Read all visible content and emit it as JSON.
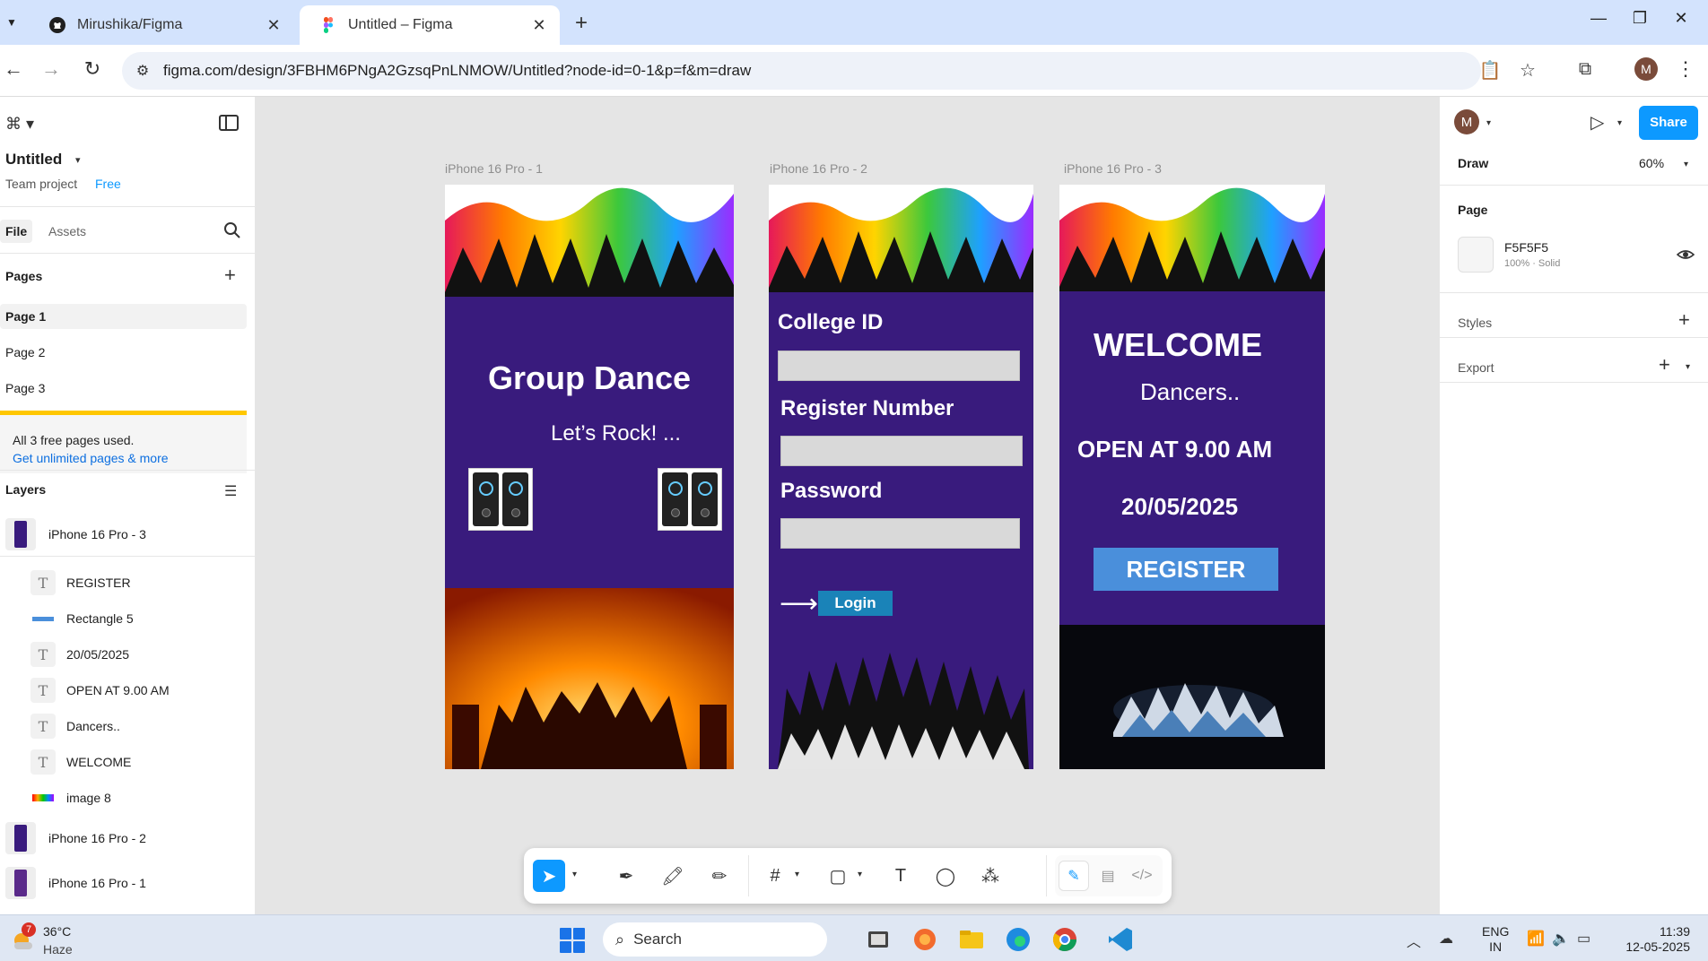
{
  "browser": {
    "tabs": [
      {
        "label": "Mirushika/Figma",
        "icon": "github-icon"
      },
      {
        "label": "Untitled – Figma",
        "icon": "figma-icon"
      }
    ],
    "url": "figma.com/design/3FBHM6PNgA2GzsqPnLNMOW/Untitled?node-id=0-1&p=f&m=draw",
    "profile_initial": "M"
  },
  "left_panel": {
    "file_title": "Untitled",
    "team": "Team project",
    "plan": "Free",
    "tabs": {
      "file": "File",
      "assets": "Assets"
    },
    "pages_heading": "Pages",
    "pages": [
      "Page 1",
      "Page 2",
      "Page 3"
    ],
    "banner": {
      "text": "All 3 free pages used.",
      "link": "Get unlimited pages & more"
    },
    "layers_heading": "Layers",
    "layers": {
      "frame3": "iPhone 16 Pro - 3",
      "children": [
        "REGISTER",
        "Rectangle 5",
        "20/05/2025",
        "OPEN AT 9.00 AM",
        "Dancers..",
        "WELCOME",
        "image 8"
      ],
      "frame2": "iPhone 16 Pro - 2",
      "frame1": "iPhone 16 Pro - 1"
    }
  },
  "canvas": {
    "frames": [
      {
        "label": "iPhone 16 Pro - 1",
        "title": "Group Dance",
        "subtitle": "Let’s Rock! ..."
      },
      {
        "label": "iPhone 16 Pro - 2",
        "fields": [
          "College ID",
          "Register Number",
          "Password"
        ],
        "arrow": "⟶",
        "button": "Login"
      },
      {
        "label": "iPhone 16 Pro - 3",
        "welcome": "WELCOME",
        "dancers": "Dancers..",
        "open": "OPEN AT 9.00 AM",
        "date": "20/05/2025",
        "button": "REGISTER"
      }
    ],
    "frame_bg": "#391b7d"
  },
  "right_panel": {
    "avatar": "M",
    "share": "Share",
    "mode": "Draw",
    "zoom": "60%",
    "page_heading": "Page",
    "page_color": "F5F5F5",
    "page_color_sub": "100% · Solid",
    "styles": "Styles",
    "export": "Export"
  },
  "taskbar": {
    "weather_badge": "7",
    "temp": "36°C",
    "condition": "Haze",
    "search": "Search",
    "lang1": "ENG",
    "lang2": "IN",
    "time": "11:39",
    "date": "12-05-2025"
  },
  "help": "?",
  "accent": "#0d99ff"
}
